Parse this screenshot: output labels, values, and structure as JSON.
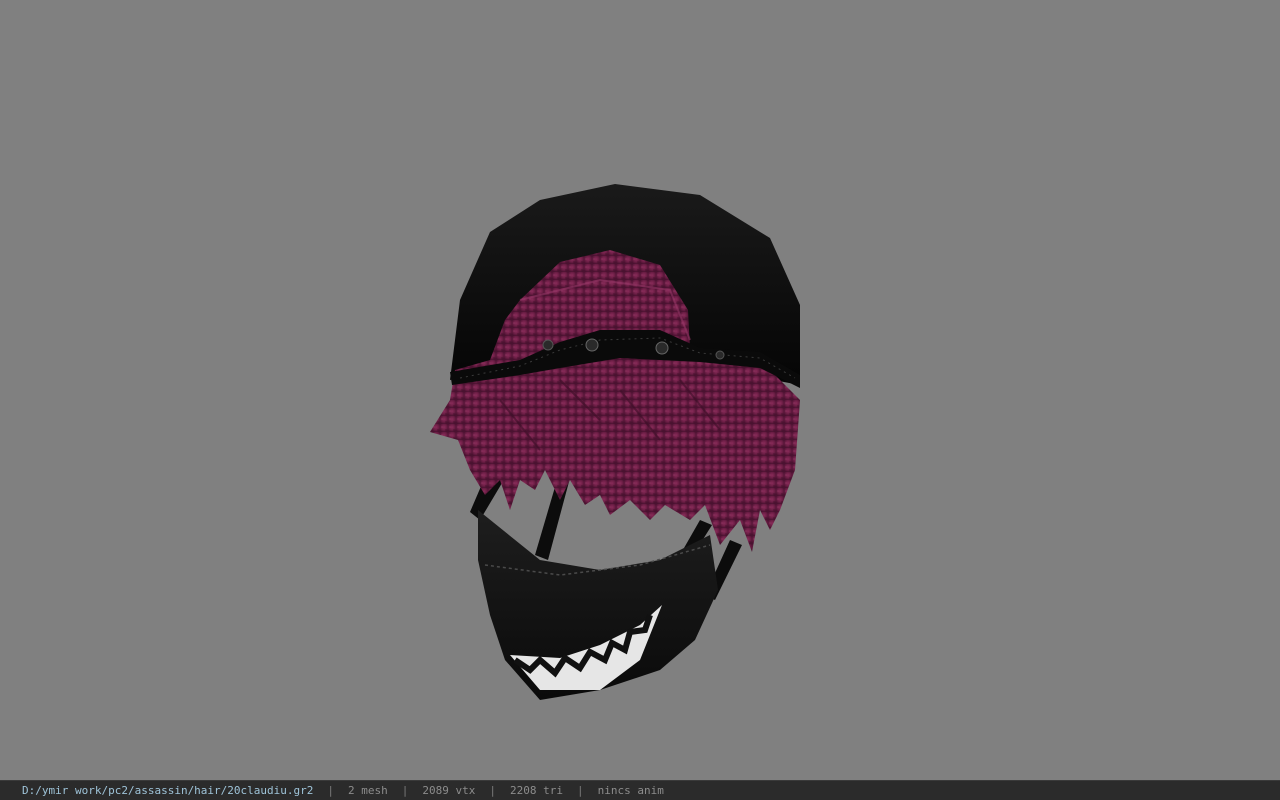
{
  "viewer": {
    "background_color": "#808080",
    "model_icon": "hair-mesh-with-cap-and-mask"
  },
  "status_bar": {
    "file_path": "D:/ymir work/pc2/assassin/hair/20claudiu.gr2",
    "separator": "|",
    "mesh_count": "2 mesh",
    "vertex_count": "2089 vtx",
    "triangle_count": "2208 tri",
    "anim_status": "nincs anim"
  },
  "colors": {
    "cap": "#0d0d0d",
    "hair": "#6e1f45",
    "mask": "#141414",
    "teeth": "#e8e8e8",
    "status_bar_bg": "#2b2b2b",
    "path_text": "#9ec3d8"
  }
}
